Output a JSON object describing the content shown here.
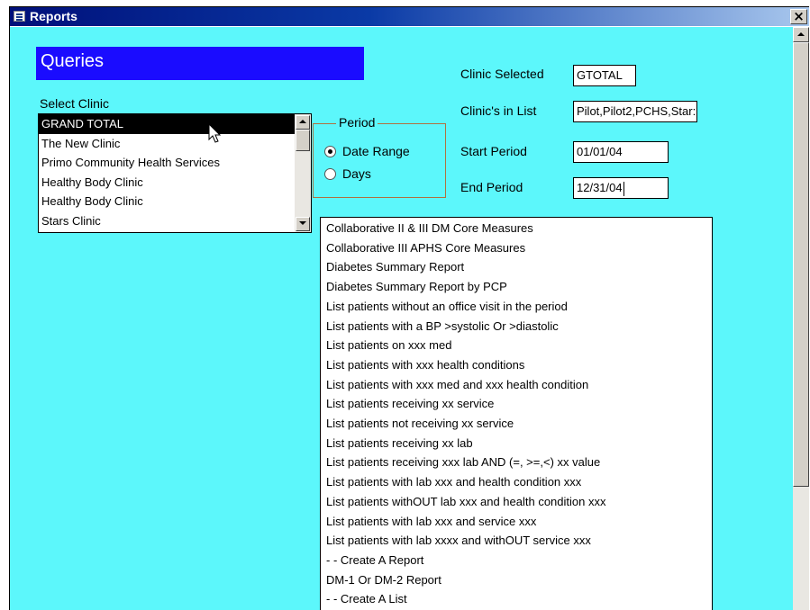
{
  "window": {
    "title": "Reports",
    "close_label": "×"
  },
  "banner": {
    "title": "Queries"
  },
  "select_clinic": {
    "label": "Select Clinic",
    "items": [
      "GRAND TOTAL",
      "The New Clinic",
      "Primo Community Health Services",
      "Healthy Body Clinic",
      "Healthy Body Clinic",
      "Stars Clinic"
    ],
    "selected_index": 0
  },
  "period": {
    "title": "Period",
    "options": [
      "Date Range",
      "Days"
    ],
    "selected": "Date Range"
  },
  "fields": {
    "clinic_selected": {
      "label": "Clinic Selected",
      "value": "GTOTAL"
    },
    "clinics_in_list": {
      "label": "Clinic's in  List",
      "value": "Pilot,Pilot2,PCHS,Star:"
    },
    "start_period": {
      "label": "Start Period",
      "value": "01/01/04"
    },
    "end_period": {
      "label": "End Period",
      "value": "12/31/04"
    }
  },
  "reports": [
    "Collaborative II & III DM Core Measures",
    "Collaborative III APHS Core Measures",
    "Diabetes Summary Report",
    "Diabetes Summary Report by PCP",
    "List patients without an office visit in the period",
    "List patients with a  BP >systolic Or >diastolic",
    "List patients on xxx med",
    "List patients with xxx health conditions",
    "List patients with xxx med and  xxx health condition",
    "List patients receiving xx service",
    "List patients not receiving xx service",
    "List patients receiving xx lab",
    "List patients receiving xxx lab AND (=, >=,<) xx value",
    "List patients with lab xxx and health condition xxx",
    "List patients withOUT lab xxx and  health condition xxx",
    "List patients with lab xxx and service xxx",
    "List patients with lab xxxx and withOUT service xxx",
    "- - Create A Report",
    "DM-1 Or DM-2 Report",
    "- - Create A List"
  ],
  "icons": [
    "form-icon",
    "close-icon",
    "scroll-up-icon",
    "scroll-down-icon",
    "radio-icon",
    "mouse-cursor-icon"
  ]
}
